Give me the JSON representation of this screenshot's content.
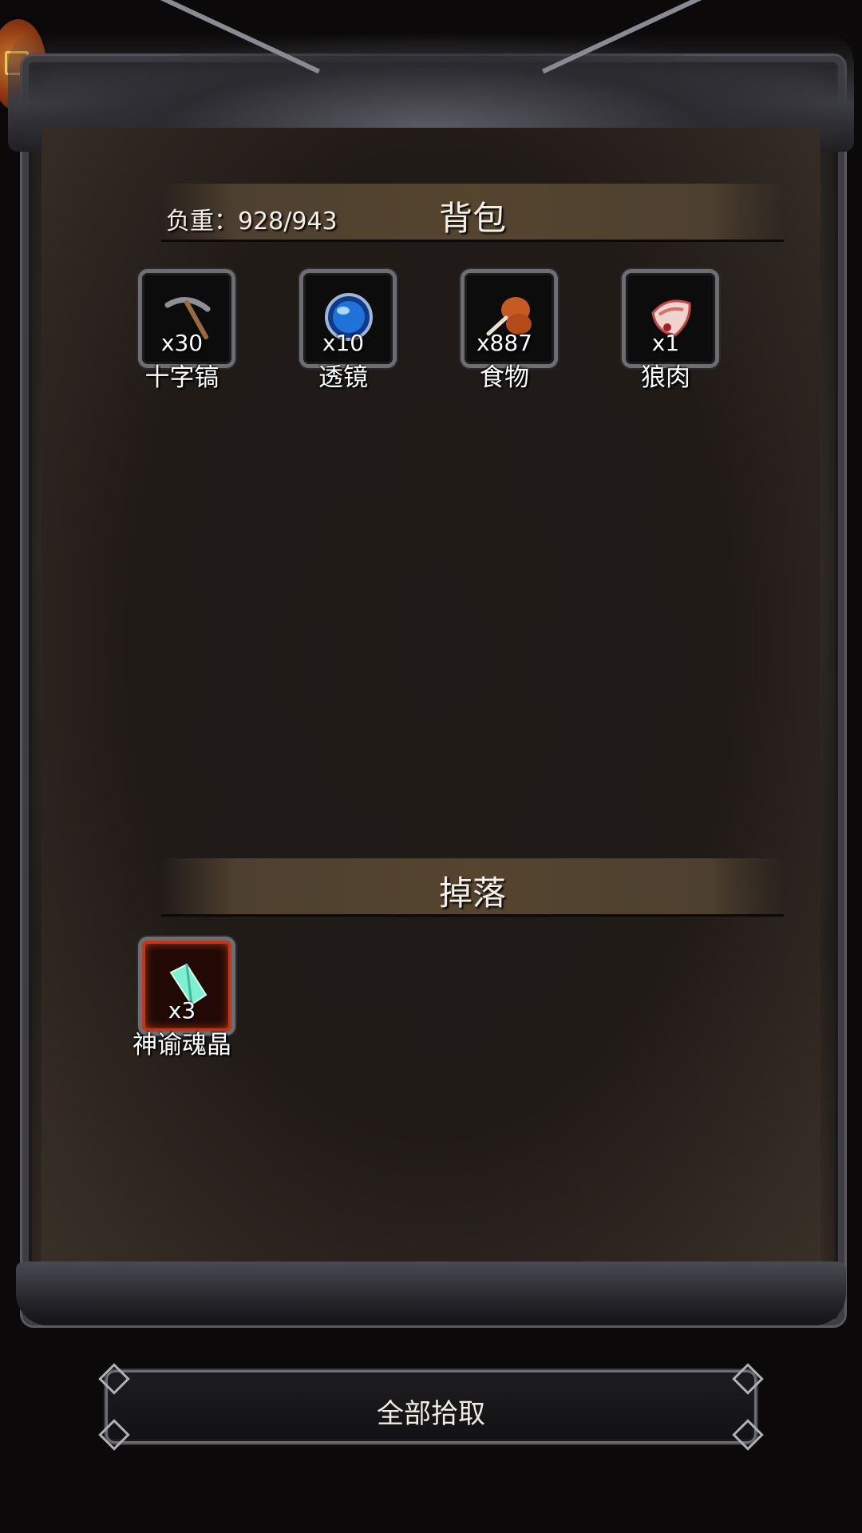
{
  "backpack": {
    "title": "背包",
    "weight_label": "负重：928/943",
    "items": [
      {
        "name": "十字镐",
        "count": "x30",
        "icon": "pickaxe-icon"
      },
      {
        "name": "透镜",
        "count": "x10",
        "icon": "lens-icon"
      },
      {
        "name": "食物",
        "count": "x887",
        "icon": "meat-drumstick-icon"
      },
      {
        "name": "狼肉",
        "count": "x1",
        "icon": "raw-meat-icon"
      }
    ]
  },
  "drops": {
    "title": "掉落",
    "items": [
      {
        "name": "神谕魂晶",
        "count": "x3",
        "icon": "soul-crystal-icon",
        "rarity_color": "#c0381a"
      }
    ]
  },
  "actions": {
    "loot_all_label": "全部拾取"
  }
}
